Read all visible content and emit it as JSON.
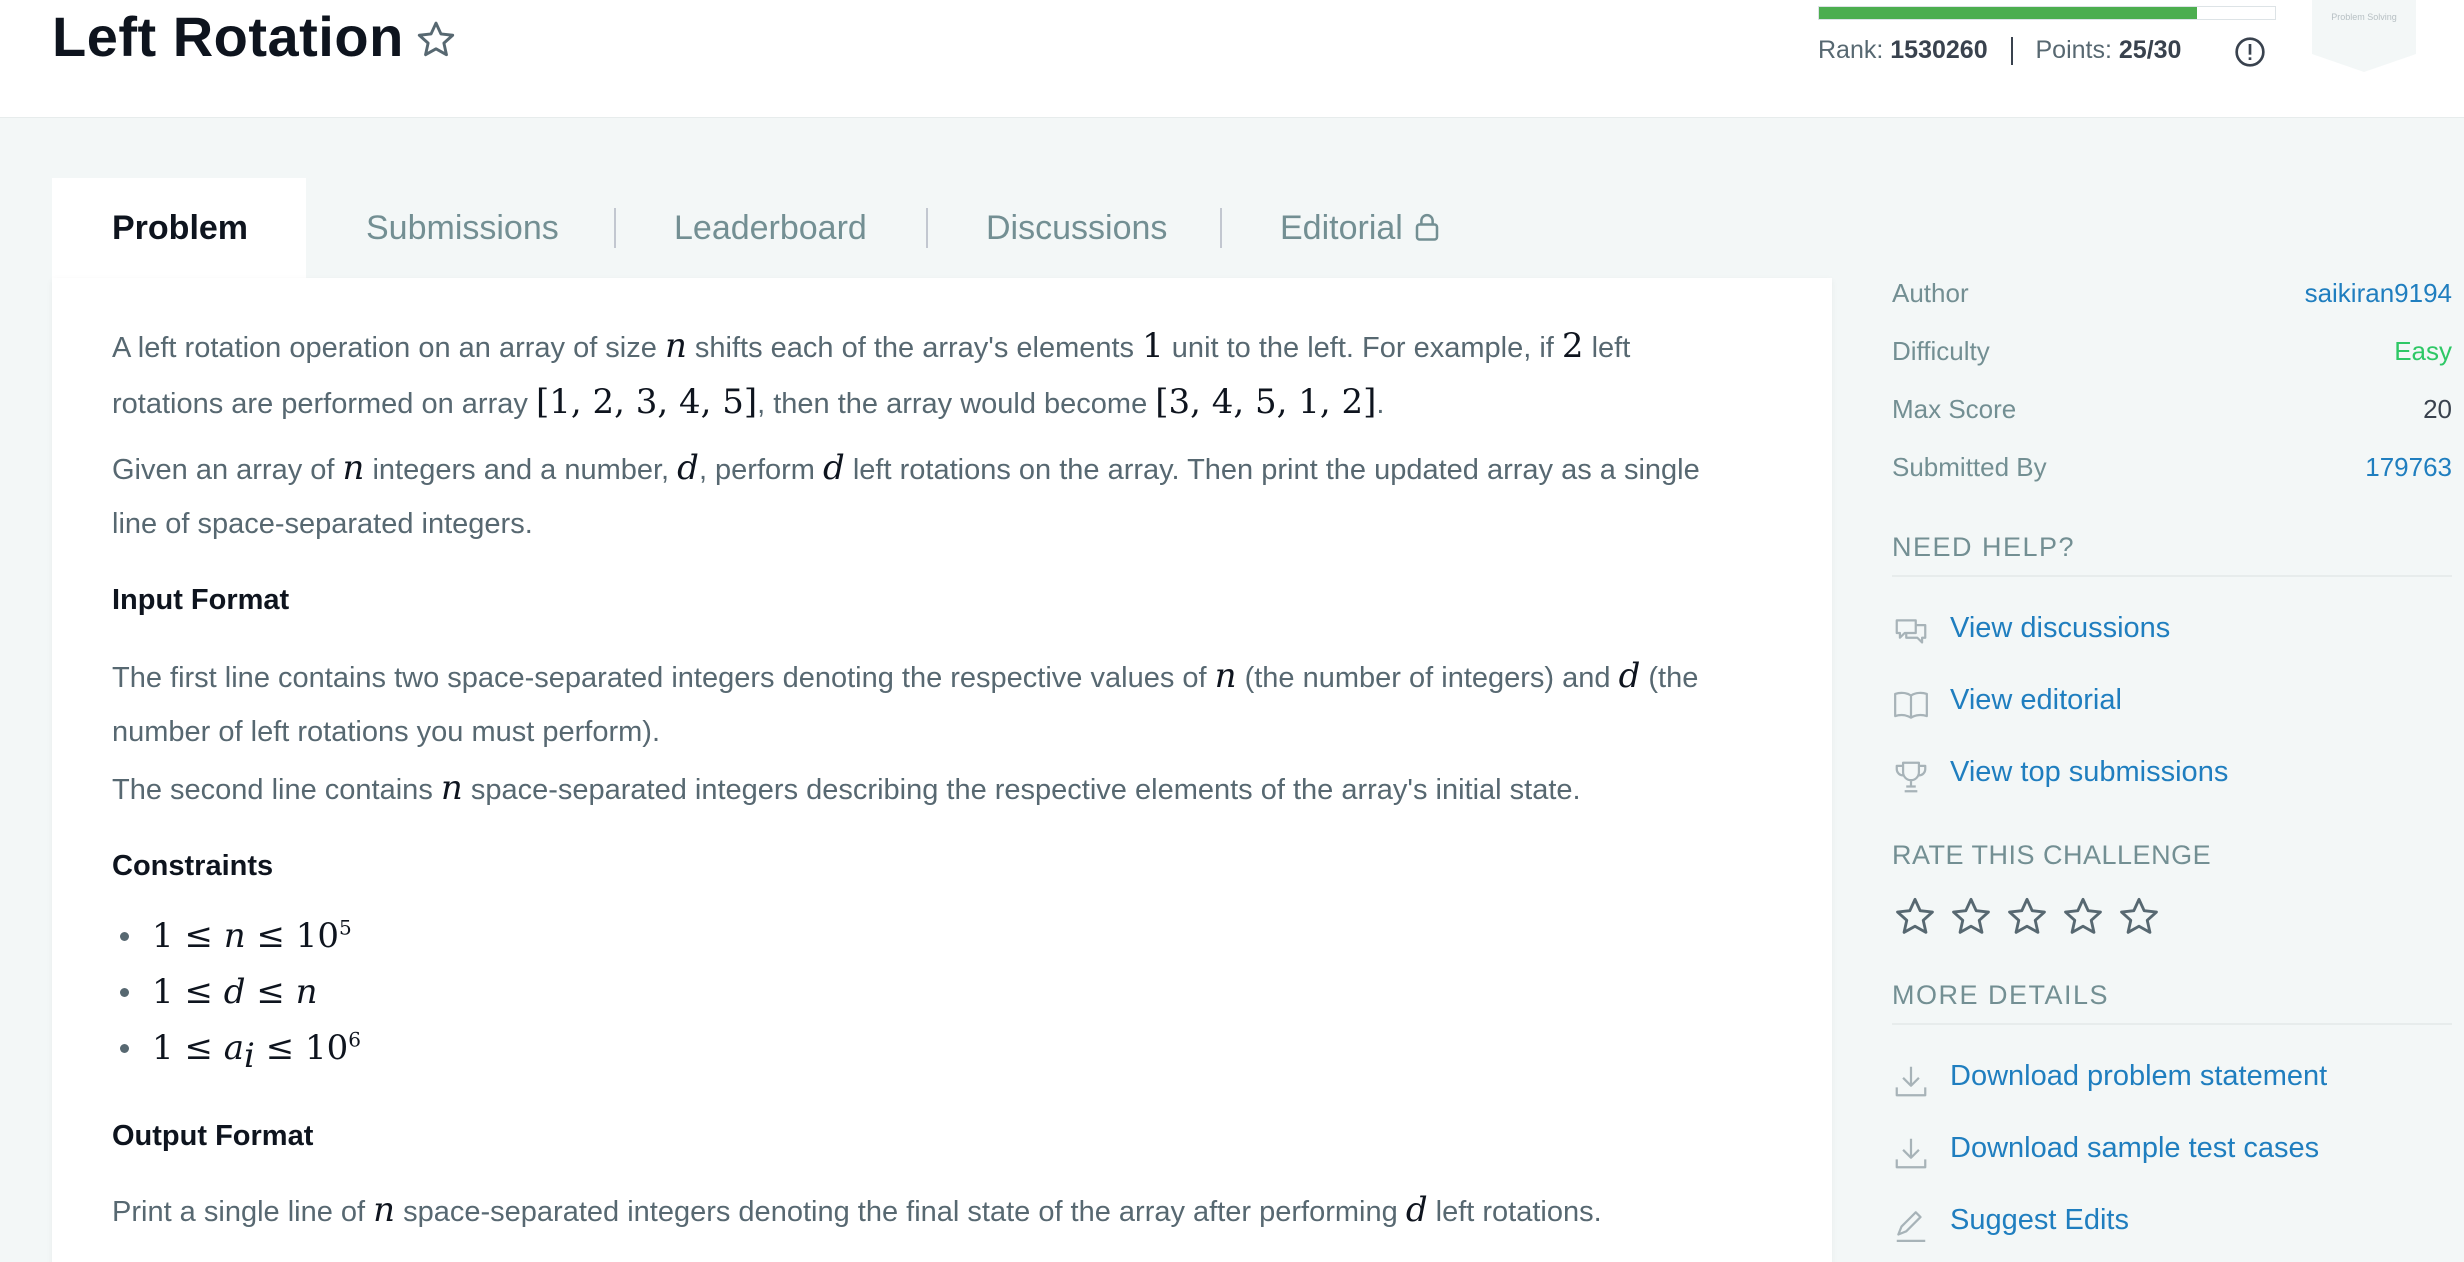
{
  "header": {
    "title": "Left Rotation",
    "progress_fraction": 0.83,
    "rank_label": "Rank:",
    "rank_value": "1530260",
    "points_label": "Points:",
    "points_value": "25/30",
    "badge_text": "Problem Solving"
  },
  "tabs": [
    {
      "label": "Problem"
    },
    {
      "label": "Submissions"
    },
    {
      "label": "Leaderboard"
    },
    {
      "label": "Discussions"
    },
    {
      "label": "Editorial"
    }
  ],
  "problem": {
    "p1a": "A left rotation operation on an array of size ",
    "p1b": " shifts each of the array's elements ",
    "p1c": " unit to the left. For example, if ",
    "p1d": " left",
    "p1e": "rotations are performed on array ",
    "p1f": ", then the array would become ",
    "p1g": ".",
    "array_before": "[1, 2, 3, 4, 5]",
    "array_after": "[3, 4, 5, 1, 2]",
    "one": "1",
    "two": "2",
    "var_n": "n",
    "var_d": "d",
    "p2a": "Given an array of ",
    "p2b": " integers and a number, ",
    "p2c": ", perform ",
    "p2d": " left rotations on the array. Then print the updated array as a single",
    "p2e": "line of space-separated integers.",
    "input_format_heading": "Input Format",
    "in1a": "The first line contains two space-separated integers denoting the respective values of ",
    "in1b": " (the number of integers) and ",
    "in1c": " (the",
    "in1d": "number of left rotations you must perform).",
    "in2a": "The second line contains ",
    "in2b": " space-separated integers describing the respective elements of the array's initial state.",
    "constraints_heading": "Constraints",
    "c1a": "1 ≤ ",
    "c1b": " ≤ 10",
    "c1sup": "5",
    "c2a": "1 ≤ ",
    "c2b": " ≤ ",
    "c3a": "1 ≤ ",
    "c3var": "a",
    "c3sub": "i",
    "c3b": " ≤ 10",
    "c3sup": "6",
    "output_format_heading": "Output Format",
    "outa": "Print a single line of ",
    "outb": " space-separated integers denoting the final state of the array after performing ",
    "outc": " left rotations."
  },
  "sidebar": {
    "author_label": "Author",
    "author_value": "saikiran9194",
    "difficulty_label": "Difficulty",
    "difficulty_value": "Easy",
    "maxscore_label": "Max Score",
    "maxscore_value": "20",
    "submitted_label": "Submitted By",
    "submitted_value": "179763",
    "need_help": "NEED HELP?",
    "view_discussions": "View discussions",
    "view_editorial": "View editorial",
    "view_top": "View top submissions",
    "rate": "RATE THIS CHALLENGE",
    "rating_stars": 0,
    "more_details": "MORE DETAILS",
    "download_statement": "Download problem statement",
    "download_tests": "Download sample test cases",
    "suggest_edits": "Suggest Edits"
  },
  "colors": {
    "accent_link": "#1f7ebf",
    "easy": "#2ec866",
    "progress": "#4cae4f",
    "title": "#0e141e"
  },
  "icons": [
    "star-outline-icon",
    "info-icon",
    "lock-icon",
    "chat-icon",
    "book-icon",
    "trophy-icon",
    "download-icon",
    "pencil-icon",
    "badge-icon"
  ]
}
